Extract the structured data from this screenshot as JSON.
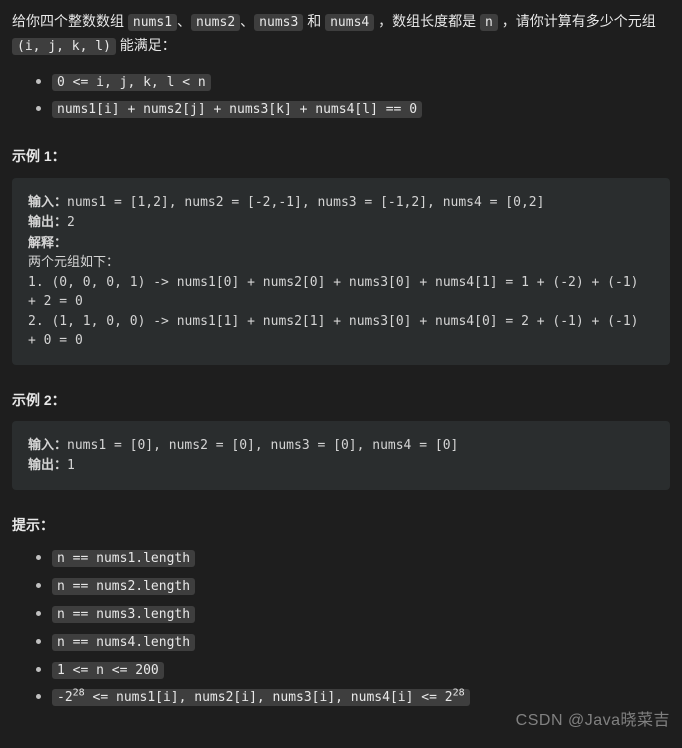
{
  "description": {
    "part1": "给你四个整数数组 ",
    "nums1": "nums1",
    "sep1": "、",
    "nums2": "nums2",
    "sep2": "、",
    "nums3": "nums3",
    "and": " 和 ",
    "nums4": "nums4",
    "part2": " ，数组长度都是 ",
    "n": "n",
    "part3": " ，请你计算有多少个元组 ",
    "tuple": "(i, j, k, l)",
    "part4": " 能满足："
  },
  "conditions": {
    "item1": "0 <= i, j, k, l < n",
    "item2": "nums1[i] + nums2[j] + nums3[k] + nums4[l] == 0"
  },
  "example1": {
    "title": "示例 1：",
    "input_label": "输入：",
    "input_value": "nums1 = [1,2], nums2 = [-2,-1], nums3 = [-1,2], nums4 = [0,2]",
    "output_label": "输出：",
    "output_value": "2",
    "explain_label": "解释：",
    "explain_line1": "两个元组如下：",
    "explain_line2": "1. (0, 0, 0, 1) -> nums1[0] + nums2[0] + nums3[0] + nums4[1] = 1 + (-2) + (-1) + 2 = 0",
    "explain_line3": "2. (1, 1, 0, 0) -> nums1[1] + nums2[1] + nums3[0] + nums4[0] = 2 + (-1) + (-1) + 0 = 0"
  },
  "example2": {
    "title": "示例 2：",
    "input_label": "输入：",
    "input_value": "nums1 = [0], nums2 = [0], nums3 = [0], nums4 = [0]",
    "output_label": "输出：",
    "output_value": "1"
  },
  "hints": {
    "title": "提示：",
    "item1": "n == nums1.length",
    "item2": "n == nums2.length",
    "item3": "n == nums3.length",
    "item4": "n == nums4.length",
    "item5": "1 <= n <= 200",
    "item6_p1": "-2",
    "item6_sup1": "28",
    "item6_p2": " <= nums1[i], nums2[i], nums3[i], nums4[i] <= 2",
    "item6_sup2": "28"
  },
  "watermark": "CSDN @Java晓菜吉"
}
